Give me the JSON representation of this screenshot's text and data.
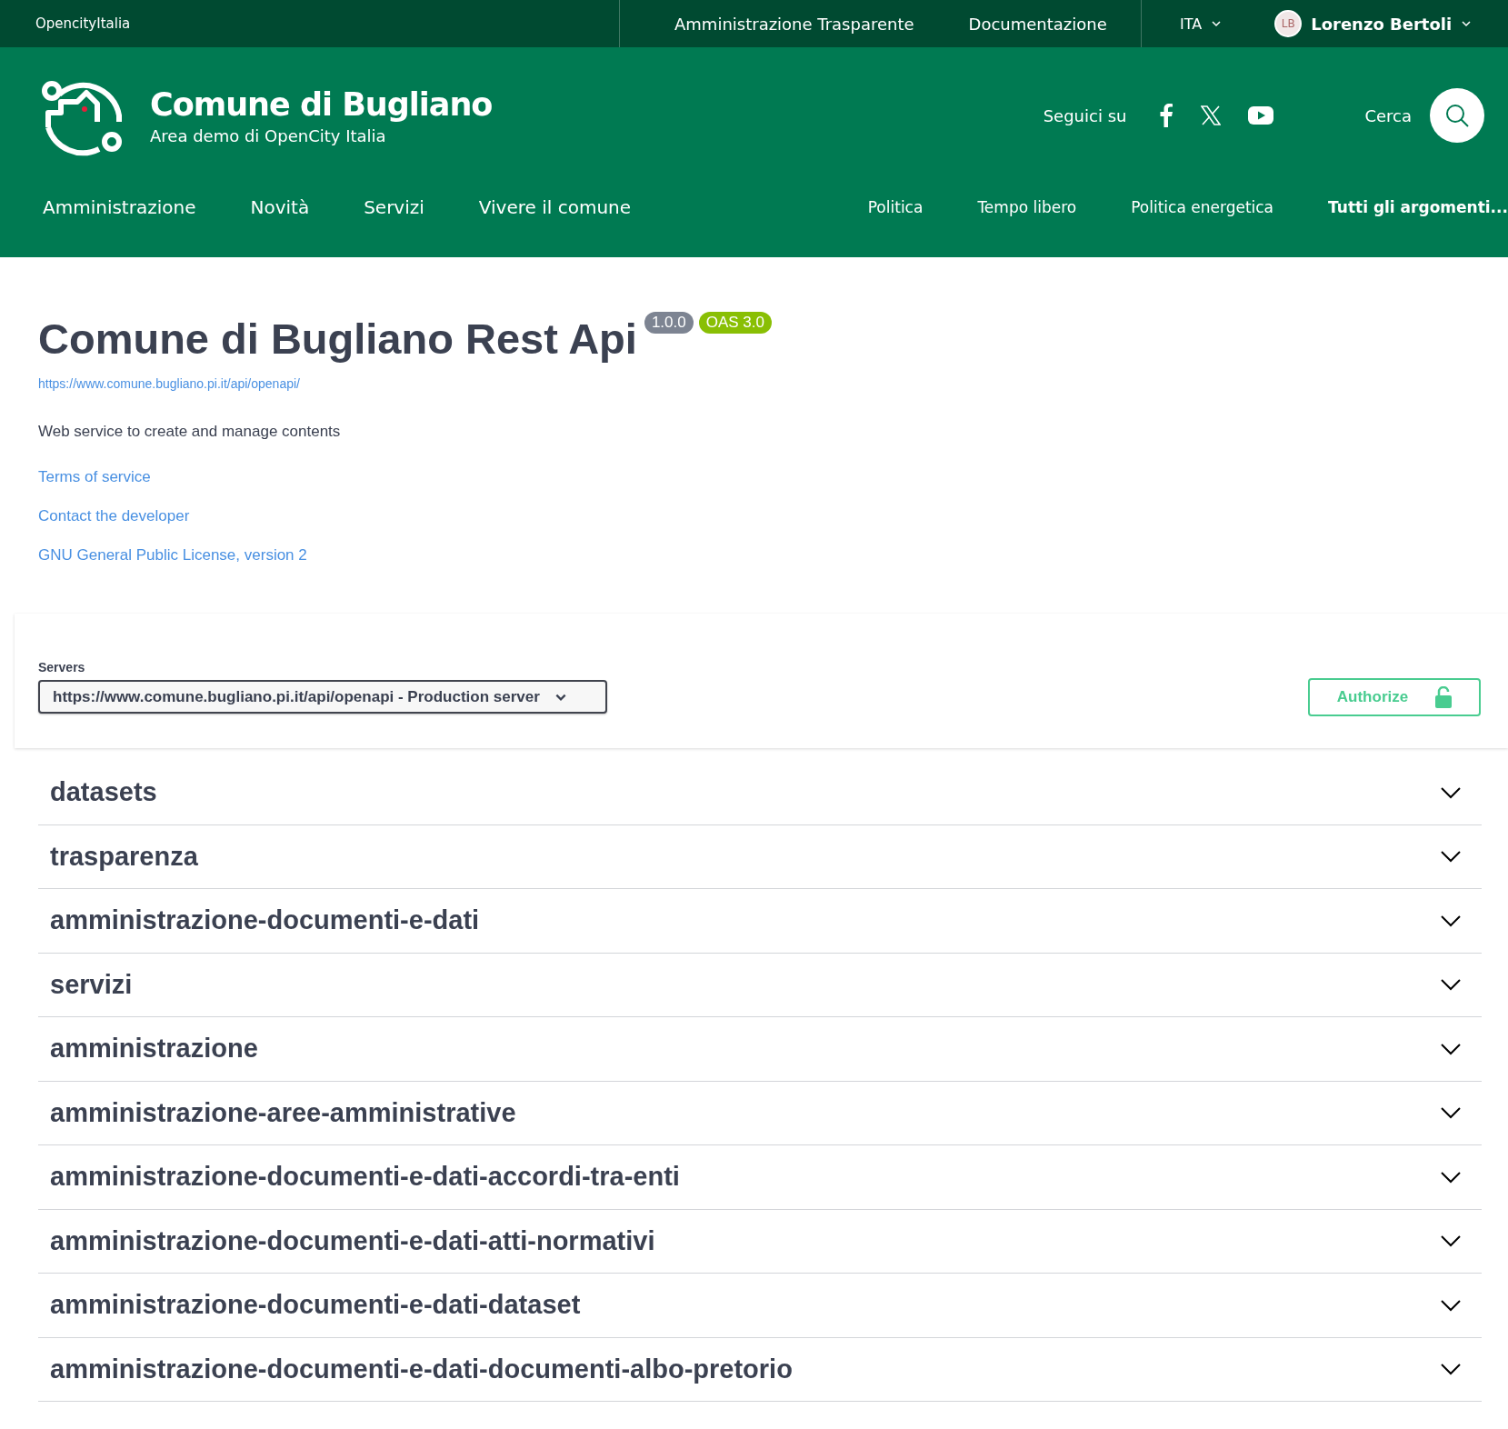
{
  "top_bar": {
    "brand": "OpencityItalia",
    "links": [
      "Amministrazione Trasparente",
      "Documentazione"
    ],
    "language": "ITA",
    "user": {
      "initials": "LB",
      "name": "Lorenzo Bertoli"
    }
  },
  "header": {
    "title": "Comune di Bugliano",
    "subtitle": "Area demo di OpenCity Italia",
    "social_label": "Seguici su",
    "search_label": "Cerca"
  },
  "main_nav": [
    "Amministrazione",
    "Novità",
    "Servizi",
    "Vivere il comune"
  ],
  "topics_nav": [
    {
      "label": "Politica",
      "emphasized": false
    },
    {
      "label": "Tempo libero",
      "emphasized": false
    },
    {
      "label": "Politica energetica",
      "emphasized": false
    },
    {
      "label": "Tutti gli argomenti...",
      "emphasized": true
    }
  ],
  "api_info": {
    "title": "Comune di Bugliano Rest Api",
    "version": "1.0.0",
    "oas": "OAS 3.0",
    "url": "https://www.comune.bugliano.pi.it/api/openapi/",
    "description": "Web service to create and manage contents",
    "links": [
      "Terms of service",
      "Contact the developer",
      "GNU General Public License, version 2"
    ]
  },
  "servers": {
    "label": "Servers",
    "value": "https://www.comune.bugliano.pi.it/api/openapi - Production server",
    "authorize": "Authorize"
  },
  "tags": [
    {
      "name": "datasets",
      "expanded": false
    },
    {
      "name": "trasparenza",
      "expanded": false
    },
    {
      "name": "amministrazione-documenti-e-dati",
      "expanded": false
    },
    {
      "name": "servizi",
      "expanded": false
    },
    {
      "name": "amministrazione",
      "expanded": false
    },
    {
      "name": "amministrazione-aree-amministrative",
      "expanded": false
    },
    {
      "name": "amministrazione-documenti-e-dati-accordi-tra-enti",
      "expanded": false
    },
    {
      "name": "amministrazione-documenti-e-dati-atti-normativi",
      "expanded": false
    },
    {
      "name": "amministrazione-documenti-e-dati-dataset",
      "expanded": false
    },
    {
      "name": "amministrazione-documenti-e-dati-documenti-albo-pretorio",
      "expanded": false
    }
  ]
}
